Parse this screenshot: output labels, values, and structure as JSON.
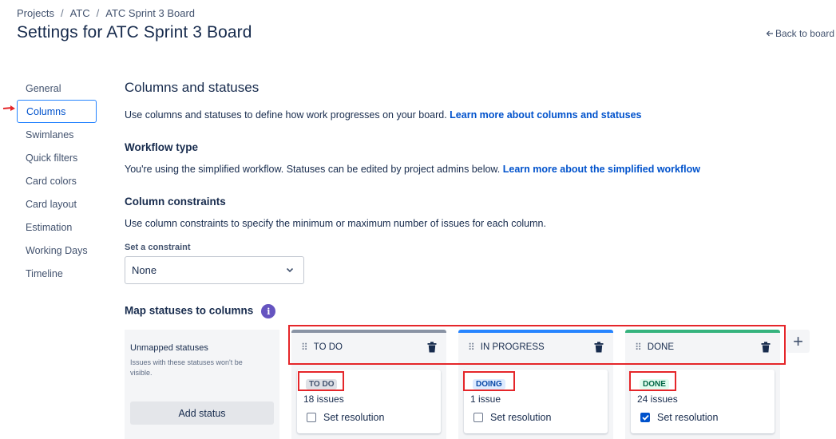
{
  "breadcrumb": [
    "Projects",
    "ATC",
    "ATC Sprint 3 Board"
  ],
  "page_title": "Settings for ATC Sprint 3 Board",
  "back_link": "Back to board",
  "sidebar": {
    "items": [
      {
        "label": "General"
      },
      {
        "label": "Columns",
        "active": true
      },
      {
        "label": "Swimlanes"
      },
      {
        "label": "Quick filters"
      },
      {
        "label": "Card colors"
      },
      {
        "label": "Card layout"
      },
      {
        "label": "Estimation"
      },
      {
        "label": "Working Days"
      },
      {
        "label": "Timeline"
      }
    ]
  },
  "main": {
    "section_title": "Columns and statuses",
    "intro_text": "Use columns and statuses to define how work progresses on your board.",
    "intro_link": "Learn more about columns and statuses",
    "workflow_title": "Workflow type",
    "workflow_text": "You're using the simplified workflow. Statuses can be edited by project admins below.",
    "workflow_link": "Learn more about the simplified workflow",
    "constraints_title": "Column constraints",
    "constraints_text": "Use column constraints to specify the minimum or maximum number of issues for each column.",
    "constraint_label": "Set a constraint",
    "constraint_value": "None",
    "map_title": "Map statuses to columns",
    "info_glyph": "i"
  },
  "unmapped": {
    "title": "Unmapped statuses",
    "description": "Issues with these statuses won't be visible.",
    "add_button": "Add status"
  },
  "columns": [
    {
      "name": "TO DO",
      "bar_color": "#8993a4",
      "status": "TO DO",
      "lozenge_bg": "#dfe1e6",
      "lozenge_fg": "#42526e",
      "issues": "18 issues",
      "resolution_label": "Set resolution",
      "resolution_checked": false
    },
    {
      "name": "IN PROGRESS",
      "bar_color": "#2684ff",
      "status": "DOING",
      "lozenge_bg": "#deebff",
      "lozenge_fg": "#0747a6",
      "issues": "1 issue",
      "resolution_label": "Set resolution",
      "resolution_checked": false
    },
    {
      "name": "DONE",
      "bar_color": "#36b37e",
      "status": "DONE",
      "lozenge_bg": "#e3fcef",
      "lozenge_fg": "#006644",
      "issues": "24 issues",
      "resolution_label": "Set resolution",
      "resolution_checked": true
    }
  ],
  "add_column_glyph": "+",
  "annotation_color": "#e5262a"
}
